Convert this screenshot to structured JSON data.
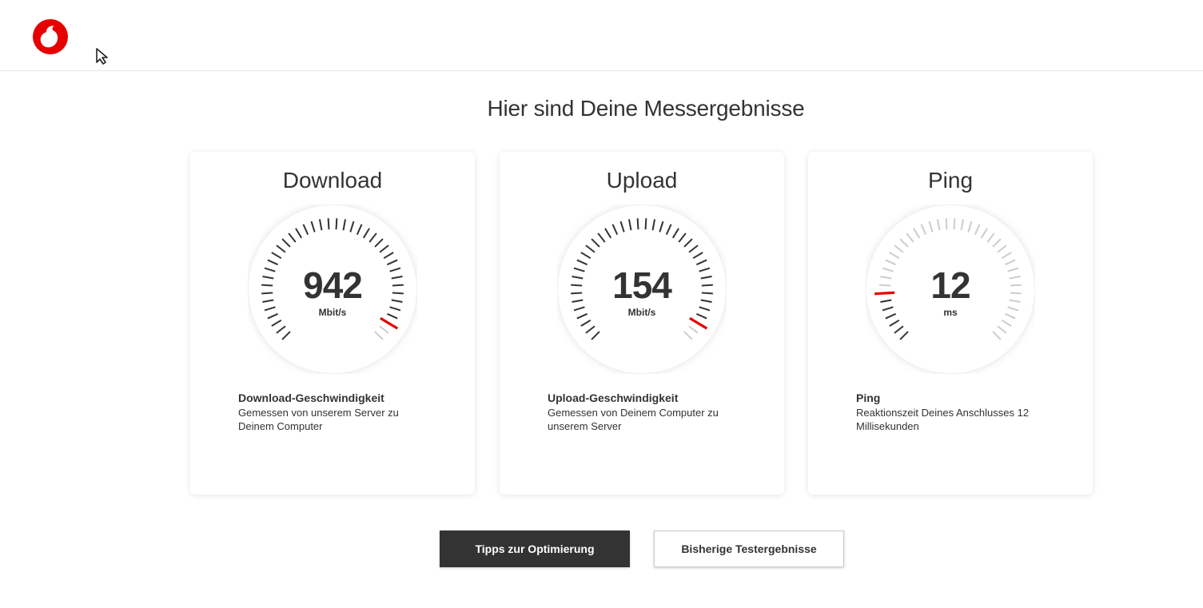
{
  "header": {
    "logo_icon": "vodafone-logo-icon",
    "brand_color": "#e60000"
  },
  "page": {
    "title": "Hier sind Deine Messergebnisse"
  },
  "cards": [
    {
      "title": "Download",
      "value": "942",
      "unit": "Mbit/s",
      "gauge_level": 0.94,
      "desc_title": "Download-Geschwindigkeit",
      "desc_text": "Gemessen von unserem Server zu Deinem Computer"
    },
    {
      "title": "Upload",
      "value": "154",
      "unit": "Mbit/s",
      "gauge_level": 0.94,
      "desc_title": "Upload-Geschwindigkeit",
      "desc_text": "Gemessen von Deinem Computer zu unserem Server"
    },
    {
      "title": "Ping",
      "value": "12",
      "unit": "ms",
      "gauge_level": 0.15,
      "desc_title": "Ping",
      "desc_text": "Reaktionszeit Deines Anschlusses 12 Millisekunden"
    }
  ],
  "buttons": {
    "tips_label": "Tipps zur Optimierung",
    "history_label": "Bisherige Testergebnisse"
  },
  "colors": {
    "accent": "#e60000",
    "tick_active": "#333333",
    "tick_inactive": "#cccccc",
    "dark_button": "#333333"
  }
}
